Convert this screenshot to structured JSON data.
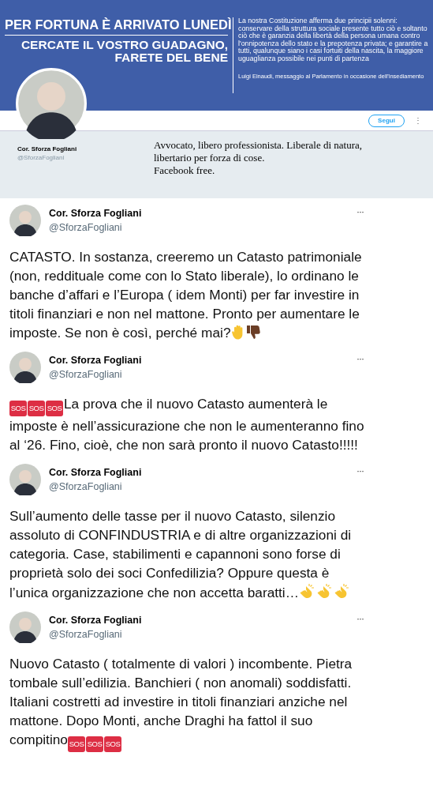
{
  "banner": {
    "headline": "PER FORTUNA È ARRIVATO LUNEDÌ",
    "subheadline": [
      "CERCATE IL VOSTRO GUADAGNO,",
      "FARETE DEL BENE"
    ],
    "quote": "La nostra Costituzione afferma due principii solenni: conservare della struttura sociale presente tutto ciò e soltanto ciò che è garanzia della libertà della persona umana contro l'onnipotenza dello stato e la prepotenza privata; e garantire a tutti, qualunque siano i casi fortuiti della nascita, la maggiore uguaglianza possibile nei punti di partenza",
    "attribution": "Luigi Einaudi, messaggio al Parlamento in occasione dell'insediamento"
  },
  "profile": {
    "name": "Cor. Sforza Fogliani",
    "handle": "@SforzaFogliani",
    "follow_button": "Segui",
    "more": "⋮",
    "bio": [
      "Avvocato, libero professionista. Liberale di natura,",
      "libertario per forza di cose.",
      "Facebook free."
    ]
  },
  "tweets": [
    {
      "name": "Cor. Sforza Fogliani",
      "handle": "@SforzaFogliani",
      "more": "···",
      "parts": [
        {
          "kind": "text",
          "text": "CATASTO. In sostanza, creeremo un Catasto patrimoniale (non, reddituale come con lo Stato liberale), lo  ordinano le banche d’affari e l’Europa ( idem Monti) per far investire in titoli finanziari e non nel mattone. Pronto per aumentare le imposte. Se non è così, perché mai?"
        },
        {
          "kind": "hand"
        },
        {
          "kind": "thumbs-down"
        }
      ]
    },
    {
      "name": "Cor. Sforza Fogliani",
      "handle": "@SforzaFogliani",
      "more": "···",
      "parts": [
        {
          "kind": "sos",
          "label": "SOS"
        },
        {
          "kind": "sos",
          "label": "SOS"
        },
        {
          "kind": "sos",
          "label": "SOS"
        },
        {
          "kind": "text",
          "text": "La prova che il nuovo Catasto aumenterà le imposte è nell’assicurazione che non le aumenteranno fino al ‘26. Fino, cioè, che non sarà pronto il nuovo Catasto!!!!!"
        }
      ]
    },
    {
      "name": "Cor. Sforza Fogliani",
      "handle": "@SforzaFogliani",
      "more": "···",
      "parts": [
        {
          "kind": "text",
          "text": "Sull’aumento delle tasse per il nuovo Catasto, silenzio assoluto di CONFINDUSTRIA e di altre organizzazioni di categoria. Case, stabilimenti e capannoni sono forse di proprietà solo dei soci Confedilizia? Oppure questa è l’unica organizzazione che non accetta baratti…"
        },
        {
          "kind": "clap"
        },
        {
          "kind": "clap"
        },
        {
          "kind": "clap"
        }
      ]
    },
    {
      "name": "Cor. Sforza Fogliani",
      "handle": "@SforzaFogliani",
      "more": "···",
      "parts": [
        {
          "kind": "text",
          "text": "Nuovo Catasto ( totalmente di valori )  incombente. Pietra tombale sull’edilizia. Banchieri ( non anomali) soddisfatti. Italiani costretti ad investire in titoli finanziari anziche nel mattone. Dopo Monti, anche Draghi ha fattol il suo compitino"
        },
        {
          "kind": "sos",
          "label": "SOS"
        },
        {
          "kind": "sos",
          "label": "SOS"
        },
        {
          "kind": "sos",
          "label": "SOS"
        }
      ]
    }
  ]
}
